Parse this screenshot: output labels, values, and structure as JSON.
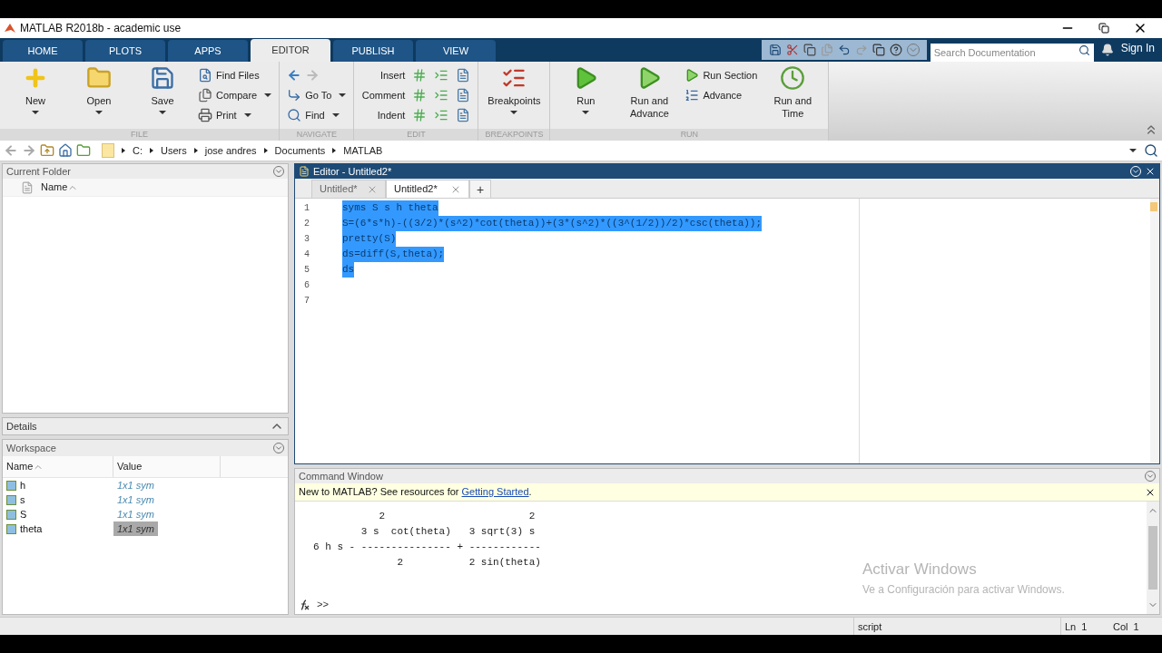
{
  "window": {
    "title": "MATLAB R2018b - academic use"
  },
  "ribbon_tabs": [
    {
      "label": "HOME",
      "selected": false
    },
    {
      "label": "PLOTS",
      "selected": false
    },
    {
      "label": "APPS",
      "selected": false
    },
    {
      "label": "EDITOR",
      "selected": true
    },
    {
      "label": "PUBLISH",
      "selected": false
    },
    {
      "label": "VIEW",
      "selected": false
    }
  ],
  "search": {
    "placeholder": "Search Documentation"
  },
  "sign_in": "Sign In",
  "ribbon_groups": [
    {
      "label": "FILE",
      "columns": [
        [
          {
            "kind": "large",
            "label": "New",
            "dropdown": true
          }
        ],
        [
          {
            "kind": "large",
            "label": "Open",
            "dropdown": true
          }
        ],
        [
          {
            "kind": "large",
            "label": "Save",
            "dropdown": true
          }
        ],
        [
          {
            "kind": "small",
            "label": "Find Files",
            "dropdown": false
          },
          {
            "kind": "small",
            "label": "Compare",
            "dropdown": true
          },
          {
            "kind": "small",
            "label": "Print",
            "dropdown": true
          }
        ]
      ]
    },
    {
      "label": "NAVIGATE",
      "columns": [
        [
          {
            "kind": "arrows"
          },
          {
            "kind": "small",
            "label": "Go To",
            "dropdown": true
          },
          {
            "kind": "small",
            "label": "Find",
            "dropdown": true
          }
        ]
      ]
    },
    {
      "label": "EDIT",
      "columns": [
        [
          {
            "kind": "edit_row",
            "label": "Insert"
          },
          {
            "kind": "edit_row",
            "label": "Comment"
          },
          {
            "kind": "edit_row",
            "label": "Indent"
          }
        ]
      ]
    },
    {
      "label": "BREAKPOINTS",
      "columns": [
        [
          {
            "kind": "large",
            "label": "Breakpoints",
            "dropdown": true
          }
        ]
      ]
    },
    {
      "label": "RUN",
      "columns": [
        [
          {
            "kind": "large",
            "label": "Run",
            "dropdown": true
          }
        ],
        [
          {
            "kind": "large",
            "label": "Run and Advance",
            "dropdown": false
          }
        ],
        [
          {
            "kind": "small",
            "label": "Run Section",
            "dropdown": false
          },
          {
            "kind": "small",
            "label": "Advance",
            "dropdown": false
          }
        ],
        [
          {
            "kind": "large",
            "label": "Run and Time",
            "dropdown": false
          }
        ]
      ]
    }
  ],
  "address_path": [
    "C:",
    "Users",
    "jose andres",
    "Documents",
    "MATLAB"
  ],
  "current_folder": {
    "title": "Current Folder",
    "column": "Name"
  },
  "details": {
    "title": "Details"
  },
  "workspace": {
    "title": "Workspace",
    "columns": [
      "Name",
      "Value"
    ],
    "rows": [
      {
        "name": "h",
        "value": "1x1 sym",
        "selected": false
      },
      {
        "name": "s",
        "value": "1x1 sym",
        "selected": false
      },
      {
        "name": "S",
        "value": "1x1 sym",
        "selected": false
      },
      {
        "name": "theta",
        "value": "1x1 sym",
        "selected": true
      }
    ]
  },
  "editor": {
    "title": "Editor - Untitled2*",
    "tabs": [
      {
        "label": "Untitled*",
        "selected": false
      },
      {
        "label": "Untitled2*",
        "selected": true
      }
    ],
    "plus": "+",
    "lines": [
      {
        "number": "1",
        "text": "syms S s h theta",
        "selected": true
      },
      {
        "number": "2",
        "text": "S=(6*s*h)-((3/2)*(s^2)*cot(theta))+(3*(s^2)*((3^(1/2))/2)*csc(theta));",
        "selected": true
      },
      {
        "number": "3",
        "text": "pretty(S)",
        "selected": true
      },
      {
        "number": "4",
        "text": "ds=diff(S,theta);",
        "selected": true
      },
      {
        "number": "5",
        "text": "ds",
        "selected": true
      },
      {
        "number": "6"
      },
      {
        "number": "7"
      }
    ]
  },
  "command_window": {
    "title": "Command Window",
    "notice": "New to MATLAB? See resources for ",
    "notice_link": "Getting Started",
    "notice_end": ".",
    "output": [
      "           2                        2",
      "        3 s  cot(theta)   3 sqrt(3) s",
      "6 h s - --------------- + ------------",
      "              2           2 sin(theta)"
    ],
    "prompt": ">>"
  },
  "activation": {
    "title": "Activar Windows",
    "subtitle": "Ve a Configuración para activar Windows."
  },
  "status_bar": {
    "mode": "script",
    "line": "Ln  1",
    "col": "Col  1"
  }
}
